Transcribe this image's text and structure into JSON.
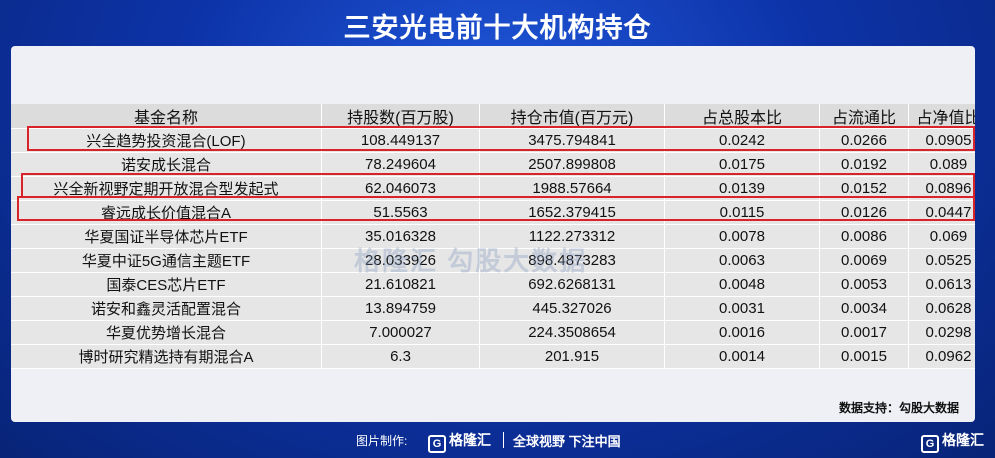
{
  "title": "三安光电前十大机构持仓",
  "table": {
    "headers": [
      "基金名称",
      "持股数(百万股)",
      "持仓市值(百万元)",
      "占总股本比",
      "占流通比",
      "占净值比"
    ],
    "rows": [
      [
        "兴全趋势投资混合(LOF)",
        "108.449137",
        "3475.794841",
        "0.0242",
        "0.0266",
        "0.0905"
      ],
      [
        "诺安成长混合",
        "78.249604",
        "2507.899808",
        "0.0175",
        "0.0192",
        "0.089"
      ],
      [
        "兴全新视野定期开放混合型发起式",
        "62.046073",
        "1988.57664",
        "0.0139",
        "0.0152",
        "0.0896"
      ],
      [
        "睿远成长价值混合A",
        "51.5563",
        "1652.379415",
        "0.0115",
        "0.0126",
        "0.0447"
      ],
      [
        "华夏国证半导体芯片ETF",
        "35.016328",
        "1122.273312",
        "0.0078",
        "0.0086",
        "0.069"
      ],
      [
        "华夏中证5G通信主题ETF",
        "28.033926",
        "898.4873283",
        "0.0063",
        "0.0069",
        "0.0525"
      ],
      [
        "国泰CES芯片ETF",
        "21.610821",
        "692.6268131",
        "0.0048",
        "0.0053",
        "0.0613"
      ],
      [
        "诺安和鑫灵活配置混合",
        "13.894759",
        "445.327026",
        "0.0031",
        "0.0034",
        "0.0628"
      ],
      [
        "华夏优势增长混合",
        "7.000027",
        "224.3508654",
        "0.0016",
        "0.0017",
        "0.0298"
      ],
      [
        "博时研究精选持有期混合A",
        "6.3",
        "201.915",
        "0.0014",
        "0.0015",
        "0.0962"
      ]
    ]
  },
  "source": "数据支持：勾股大数据",
  "footer": {
    "credit": "图片制作:",
    "logo_text": "格隆汇",
    "logo_glyph": "G",
    "slogan": "全球视野 下注中国"
  },
  "watermark": "格隆汇  勾股大数据",
  "colors": {
    "background": "#0d33a8",
    "highlight_border": "#d8232a",
    "card": "#eef0f6"
  }
}
